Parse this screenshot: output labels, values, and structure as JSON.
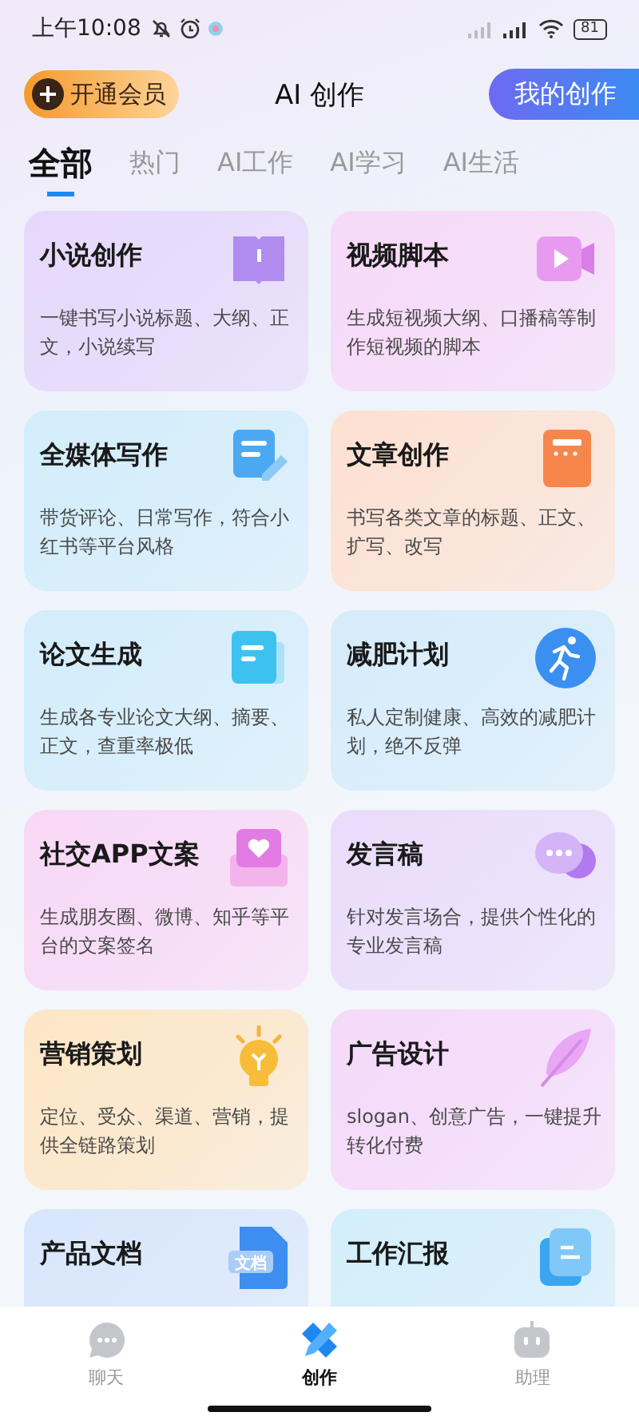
{
  "status_bar": {
    "time": "上午10:08",
    "battery": "81"
  },
  "header": {
    "vip_button": "开通会员",
    "title": "AI 创作",
    "my_button": "我的创作"
  },
  "tabs": [
    {
      "label": "全部",
      "selected": true
    },
    {
      "label": "热门",
      "selected": false
    },
    {
      "label": "AI工作",
      "selected": false
    },
    {
      "label": "AI学习",
      "selected": false
    },
    {
      "label": "AI生活",
      "selected": false
    }
  ],
  "cards": [
    {
      "title": "小说创作",
      "description": "一键书写小说标题、大纲、正文，小说续写",
      "kind": "book",
      "color": "#e6d8fb"
    },
    {
      "title": "视频脚本",
      "description": "生成短视频大纲、口播稿等制作短视频的脚本",
      "kind": "video",
      "color": "#f7d9f8"
    },
    {
      "title": "全媒体写作",
      "description": "带货评论、日常写作，符合小红书等平台风格",
      "kind": "compose",
      "color": "#d3edfb"
    },
    {
      "title": "文章创作",
      "description": "书写各类文章的标题、正文、扩写、改写",
      "kind": "notebook",
      "color": "#fde1d2"
    },
    {
      "title": "论文生成",
      "description": "生成各专业论文大纲、摘要、正文，查重率极低",
      "kind": "paper",
      "color": "#d3edfb"
    },
    {
      "title": "减肥计划",
      "description": "私人定制健康、高效的减肥计划，绝不反弹",
      "kind": "runner",
      "color": "#d6ecfb"
    },
    {
      "title": "社交APP文案",
      "description": "生成朋友圈、微博、知乎等平台的文案签名",
      "kind": "heart",
      "color": "#f8d8f6"
    },
    {
      "title": "发言稿",
      "description": "针对发言场合，提供个性化的专业发言稿",
      "kind": "chat",
      "color": "#eadcfb"
    },
    {
      "title": "营销策划",
      "description": "定位、受众、渠道、营销，提供全链路策划",
      "kind": "bulb",
      "color": "#fde6c6"
    },
    {
      "title": "广告设计",
      "description": "slogan、创意广告，一键提升转化付费",
      "kind": "feather",
      "color": "#f5d9fa"
    },
    {
      "title": "产品文档",
      "kind": "tagged",
      "icon_label": "文档",
      "color": "#d8e6fc"
    },
    {
      "title": "工作汇报",
      "kind": "files",
      "color": "#d3eefb"
    }
  ],
  "nav": [
    {
      "label": "聊天",
      "kind": "chat",
      "selected": false
    },
    {
      "label": "创作",
      "kind": "create",
      "selected": true
    },
    {
      "label": "助理",
      "kind": "robot",
      "selected": false
    }
  ]
}
